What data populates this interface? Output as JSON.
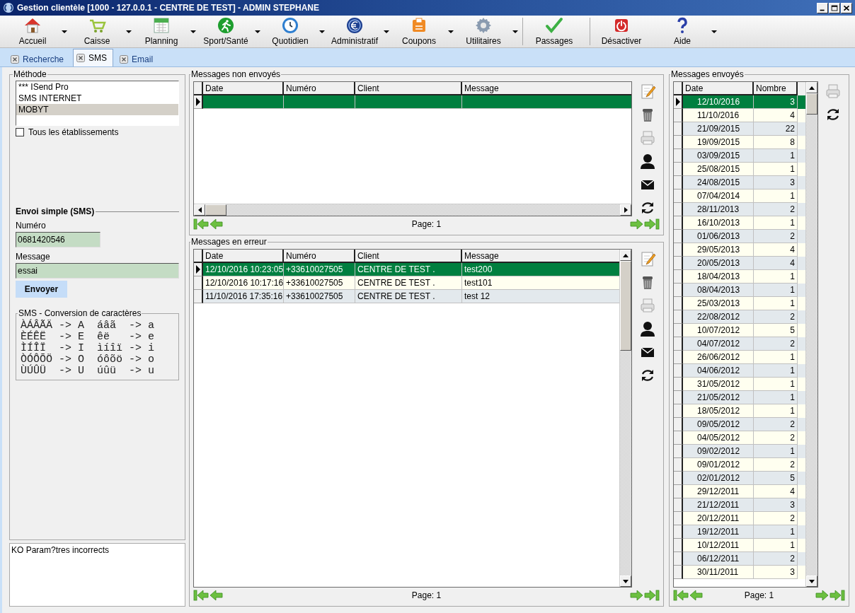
{
  "window": {
    "title": "Gestion clientèle [1000 - 127.0.0.1 - CENTRE DE TEST] - ADMIN STEPHANE"
  },
  "toolbar": [
    {
      "label": "Accueil",
      "dropdown": true
    },
    {
      "label": "Caisse",
      "dropdown": true
    },
    {
      "label": "Planning",
      "dropdown": true
    },
    {
      "label": "Sport/Santé",
      "dropdown": true
    },
    {
      "label": "Quotidien",
      "dropdown": true
    },
    {
      "label": "Administratif",
      "dropdown": true
    },
    {
      "label": "Coupons",
      "dropdown": true
    },
    {
      "label": "Utilitaires",
      "dropdown": true
    },
    {
      "label": "Passages",
      "dropdown": false
    },
    {
      "label": "Désactiver",
      "dropdown": false
    },
    {
      "label": "Aide",
      "dropdown": true
    }
  ],
  "tabs": [
    {
      "label": "Recherche",
      "selected": false
    },
    {
      "label": "SMS",
      "selected": true
    },
    {
      "label": "Email",
      "selected": false
    }
  ],
  "method": {
    "title": "Méthode",
    "options": [
      {
        "label": "*** ISend Pro",
        "selected": false
      },
      {
        "label": "SMS INTERNET",
        "selected": false
      },
      {
        "label": "MOBYT",
        "selected": true
      }
    ],
    "all_establishments": {
      "label": "Tous les établissements",
      "checked": false
    }
  },
  "simple_send": {
    "title": "Envoi simple (SMS)",
    "number_label": "Numéro",
    "number_value": "0681420546",
    "message_label": "Message",
    "message_value": "essai",
    "button": "Envoyer"
  },
  "conversion": {
    "title": "SMS - Conversion de caractères",
    "rows": [
      "ÀÁÂÃÄ -> A  áâã  -> a",
      "ÈÉÊË  -> E  êë   -> e",
      "ÌÍÎÏ  -> I  ìíîï -> i",
      "ÒÓÔÕÖ -> O  óôõö -> o",
      "ÙÚÛÜ  -> U  úûü  -> u"
    ]
  },
  "status_message": "KO Param?tres incorrects",
  "unsent": {
    "title": "Messages non envoyés",
    "columns": [
      "Date",
      "Numéro",
      "Client",
      "Message"
    ],
    "rows": [
      {
        "selected": true
      }
    ],
    "page": "Page: 1"
  },
  "errors": {
    "title": "Messages en erreur",
    "columns": [
      "Date",
      "Numéro",
      "Client",
      "Message"
    ],
    "rows": [
      {
        "date": "12/10/2016 10:23:05",
        "number": "+33610027505",
        "client": "CENTRE DE TEST .",
        "message": "test200",
        "selected": true
      },
      {
        "date": "12/10/2016 10:17:16",
        "number": "+33610027505",
        "client": "CENTRE DE TEST .",
        "message": "test101",
        "selected": false
      },
      {
        "date": "11/10/2016 17:35:16",
        "number": "+33610027505",
        "client": "CENTRE DE TEST .",
        "message": "test 12",
        "selected": false
      }
    ],
    "page": "Page: 1"
  },
  "sent": {
    "title": "Messages envoyés",
    "columns": [
      "Date",
      "Nombre"
    ],
    "rows": [
      {
        "date": "12/10/2016",
        "count": "3",
        "selected": true
      },
      {
        "date": "11/10/2016",
        "count": "4",
        "selected": false
      },
      {
        "date": "21/09/2015",
        "count": "22",
        "selected": false
      },
      {
        "date": "19/09/2015",
        "count": "8",
        "selected": false
      },
      {
        "date": "03/09/2015",
        "count": "1",
        "selected": false
      },
      {
        "date": "25/08/2015",
        "count": "1",
        "selected": false
      },
      {
        "date": "24/08/2015",
        "count": "3",
        "selected": false
      },
      {
        "date": "07/04/2014",
        "count": "1",
        "selected": false
      },
      {
        "date": "28/11/2013",
        "count": "2",
        "selected": false
      },
      {
        "date": "16/10/2013",
        "count": "1",
        "selected": false
      },
      {
        "date": "01/06/2013",
        "count": "2",
        "selected": false
      },
      {
        "date": "29/05/2013",
        "count": "4",
        "selected": false
      },
      {
        "date": "20/05/2013",
        "count": "4",
        "selected": false
      },
      {
        "date": "18/04/2013",
        "count": "1",
        "selected": false
      },
      {
        "date": "08/04/2013",
        "count": "1",
        "selected": false
      },
      {
        "date": "25/03/2013",
        "count": "1",
        "selected": false
      },
      {
        "date": "22/08/2012",
        "count": "2",
        "selected": false
      },
      {
        "date": "10/07/2012",
        "count": "5",
        "selected": false
      },
      {
        "date": "04/07/2012",
        "count": "2",
        "selected": false
      },
      {
        "date": "26/06/2012",
        "count": "1",
        "selected": false
      },
      {
        "date": "04/06/2012",
        "count": "1",
        "selected": false
      },
      {
        "date": "31/05/2012",
        "count": "1",
        "selected": false
      },
      {
        "date": "21/05/2012",
        "count": "1",
        "selected": false
      },
      {
        "date": "18/05/2012",
        "count": "1",
        "selected": false
      },
      {
        "date": "09/05/2012",
        "count": "2",
        "selected": false
      },
      {
        "date": "04/05/2012",
        "count": "2",
        "selected": false
      },
      {
        "date": "09/02/2012",
        "count": "1",
        "selected": false
      },
      {
        "date": "09/01/2012",
        "count": "2",
        "selected": false
      },
      {
        "date": "02/01/2012",
        "count": "5",
        "selected": false
      },
      {
        "date": "29/12/2011",
        "count": "4",
        "selected": false
      },
      {
        "date": "21/12/2011",
        "count": "3",
        "selected": false
      },
      {
        "date": "20/12/2011",
        "count": "2",
        "selected": false
      },
      {
        "date": "19/12/2011",
        "count": "1",
        "selected": false
      },
      {
        "date": "10/12/2011",
        "count": "1",
        "selected": false
      },
      {
        "date": "06/12/2011",
        "count": "2",
        "selected": false
      },
      {
        "date": "30/11/2011",
        "count": "3",
        "selected": false
      }
    ],
    "page": "Page: 1"
  }
}
